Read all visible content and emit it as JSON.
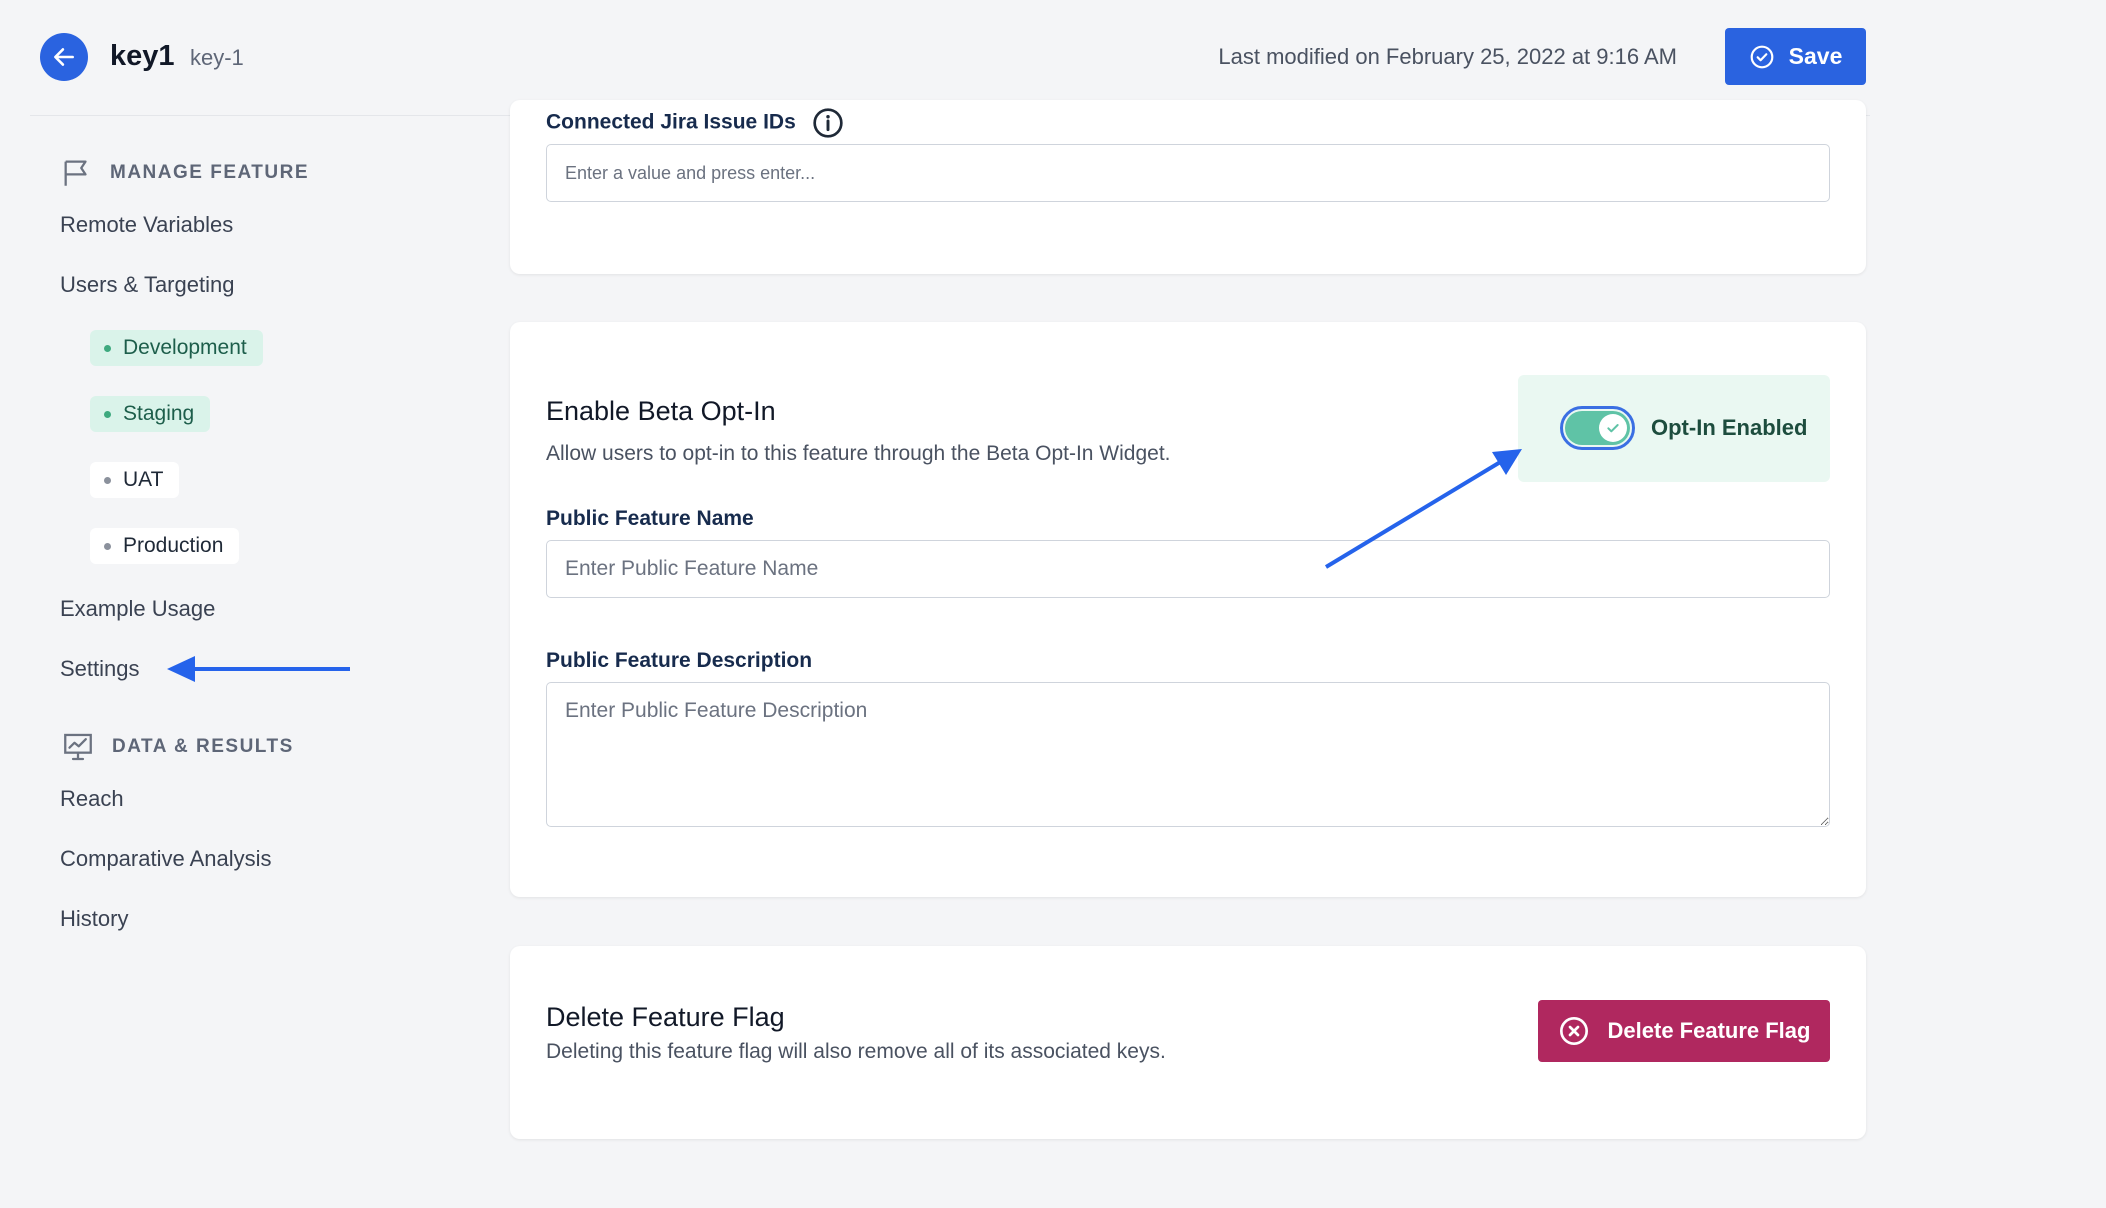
{
  "header": {
    "title": "key1",
    "subtitle": "key-1",
    "last_modified": "Last modified on February 25, 2022 at 9:16 AM",
    "save_label": "Save"
  },
  "sidebar": {
    "manage_heading": "MANAGE FEATURE",
    "manage_items": [
      "Remote Variables",
      "Users & Targeting"
    ],
    "environments": [
      {
        "label": "Development",
        "active": true
      },
      {
        "label": "Staging",
        "active": true
      },
      {
        "label": "UAT",
        "active": false
      },
      {
        "label": "Production",
        "active": false
      }
    ],
    "more_items": [
      "Example Usage",
      "Settings"
    ],
    "data_heading": "DATA & RESULTS",
    "data_items": [
      "Reach",
      "Comparative Analysis",
      "History"
    ]
  },
  "jira": {
    "label": "Connected Jira Issue IDs",
    "placeholder": "Enter a value and press enter..."
  },
  "beta": {
    "title": "Enable Beta Opt-In",
    "description": "Allow users to opt-in to this feature through the Beta Opt-In Widget.",
    "toggle_label": "Opt-In Enabled",
    "toggle_on": true,
    "name_label": "Public Feature Name",
    "name_placeholder": "Enter Public Feature Name",
    "desc_label": "Public Feature Description",
    "desc_placeholder": "Enter Public Feature Description"
  },
  "delete": {
    "title": "Delete Feature Flag",
    "description": "Deleting this feature flag will also remove all of its associated keys.",
    "button_label": "Delete Feature Flag"
  },
  "colors": {
    "primary": "#2a63e0",
    "danger": "#b0285f",
    "env_active_bg": "#daf3ea",
    "toggle_on": "#5fc3a6",
    "annotation_arrow": "#2563eb"
  }
}
